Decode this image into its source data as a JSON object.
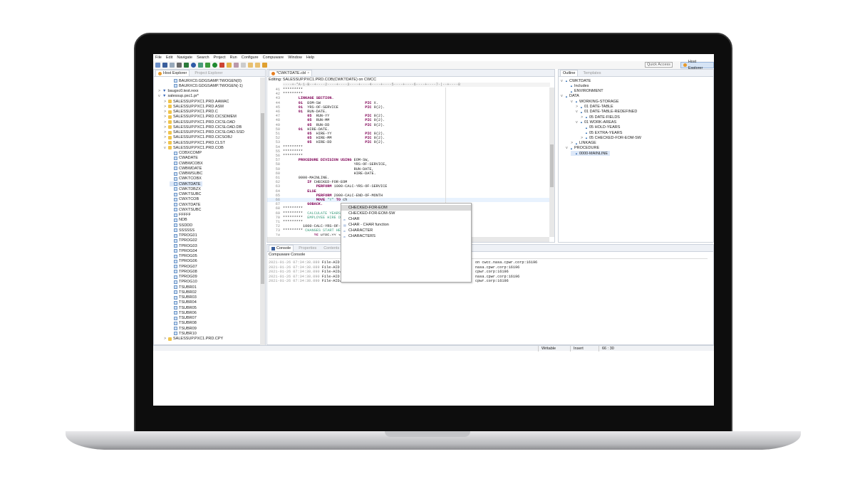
{
  "menu": [
    "File",
    "Edit",
    "Navigate",
    "Search",
    "Project",
    "Run",
    "Configure",
    "Compuware",
    "Window",
    "Help"
  ],
  "quick_access": "Quick Access",
  "perspective": "Host Explorer",
  "left_tabs": [
    "Host Explorer",
    "Project Explorer"
  ],
  "tree": [
    {
      "level": 3,
      "icon": "file",
      "label": "BAURXC0.GDGSAMP.TWOGEN(0)"
    },
    {
      "level": 3,
      "icon": "file",
      "label": "BAURXC0.GDGSAMP.TWOGEN(-1)"
    },
    {
      "level": 1,
      "icon": "filter",
      "label": "baugxc0.test.rexx",
      "toggle": ">"
    },
    {
      "level": 1,
      "icon": "filter",
      "label": "salessup.pxc1.pr*",
      "toggle": "v"
    },
    {
      "level": 2,
      "icon": "folder",
      "label": "SALESSUP.PXC1.PRD.AAMAC",
      "toggle": ">"
    },
    {
      "level": 2,
      "icon": "folder",
      "label": "SALESSUP.PXC1.PRD.ASM",
      "toggle": ">"
    },
    {
      "level": 2,
      "icon": "folder",
      "label": "SALESSUP.PXC1.PRD.C",
      "toggle": ">"
    },
    {
      "level": 2,
      "icon": "folder",
      "label": "SALESSUP.PXC1.PRD.CICSDMEM",
      "toggle": ">"
    },
    {
      "level": 2,
      "icon": "folder",
      "label": "SALESSUP.PXC1.PRD.CICSLOAD",
      "toggle": ">"
    },
    {
      "level": 2,
      "icon": "folder",
      "label": "SALESSUP.PXC1.PRD.CICSLOAD.DB",
      "toggle": ">"
    },
    {
      "level": 2,
      "icon": "folder",
      "label": "SALESSUP.PXC1.PRD.CICSLOAD.SSD",
      "toggle": ">"
    },
    {
      "level": 2,
      "icon": "folder",
      "label": "SALESSUP.PXC1.PRD.CICSOBJ",
      "toggle": ">"
    },
    {
      "level": 2,
      "icon": "folder",
      "label": "SALESSUP.PXC1.PRD.CLST",
      "toggle": ">"
    },
    {
      "level": 2,
      "icon": "folder",
      "label": "SALESSUP.PXC1.PRD.COB",
      "toggle": "v"
    },
    {
      "level": 3,
      "icon": "file",
      "label": "COBXCOMP"
    },
    {
      "level": 3,
      "icon": "file",
      "label": "CWADATE"
    },
    {
      "level": 3,
      "icon": "file",
      "label": "CWBWCOBX"
    },
    {
      "level": 3,
      "icon": "file",
      "label": "CWBWDATE"
    },
    {
      "level": 3,
      "icon": "file",
      "label": "CWBWSUBC"
    },
    {
      "level": 3,
      "icon": "file",
      "label": "CWKTCOBX"
    },
    {
      "level": 3,
      "icon": "file",
      "label": "CWKTDATE",
      "selected": true
    },
    {
      "level": 3,
      "icon": "file",
      "label": "CWKTDBZX"
    },
    {
      "level": 3,
      "icon": "file",
      "label": "CWKTSUBC"
    },
    {
      "level": 3,
      "icon": "file",
      "label": "CWXTCOB"
    },
    {
      "level": 3,
      "icon": "file",
      "label": "CWXTDATE"
    },
    {
      "level": 3,
      "icon": "file",
      "label": "CWXTSUBC"
    },
    {
      "level": 3,
      "icon": "file",
      "label": "FFFFF"
    },
    {
      "level": 3,
      "icon": "file",
      "label": "NDB"
    },
    {
      "level": 3,
      "icon": "file",
      "label": "SSDDD"
    },
    {
      "level": 3,
      "icon": "file",
      "label": "SSSSSS"
    },
    {
      "level": 3,
      "icon": "file",
      "label": "TPROG01"
    },
    {
      "level": 3,
      "icon": "file",
      "label": "TPROG02"
    },
    {
      "level": 3,
      "icon": "file",
      "label": "TPROG03"
    },
    {
      "level": 3,
      "icon": "file",
      "label": "TPROG04"
    },
    {
      "level": 3,
      "icon": "file",
      "label": "TPROG05"
    },
    {
      "level": 3,
      "icon": "file",
      "label": "TPROG06"
    },
    {
      "level": 3,
      "icon": "file",
      "label": "TPROG07"
    },
    {
      "level": 3,
      "icon": "file",
      "label": "TPROG08"
    },
    {
      "level": 3,
      "icon": "file",
      "label": "TPROG09"
    },
    {
      "level": 3,
      "icon": "file",
      "label": "TPROG10"
    },
    {
      "level": 3,
      "icon": "file",
      "label": "TSUBR01"
    },
    {
      "level": 3,
      "icon": "file",
      "label": "TSUBR02"
    },
    {
      "level": 3,
      "icon": "file",
      "label": "TSUBR03"
    },
    {
      "level": 3,
      "icon": "file",
      "label": "TSUBR04"
    },
    {
      "level": 3,
      "icon": "file",
      "label": "TSUBR05"
    },
    {
      "level": 3,
      "icon": "file",
      "label": "TSUBR06"
    },
    {
      "level": 3,
      "icon": "file",
      "label": "TSUBR07"
    },
    {
      "level": 3,
      "icon": "file",
      "label": "TSUBR08"
    },
    {
      "level": 3,
      "icon": "file",
      "label": "TSUBR09"
    },
    {
      "level": 3,
      "icon": "file",
      "label": "TSUBR10"
    },
    {
      "level": 2,
      "icon": "folder",
      "label": "SALESSUP.PXC1.PRD.CPY",
      "toggle": ">"
    }
  ],
  "editor": {
    "tab": "*CWKTDATE.cbl",
    "editing": "Editing: SALESSUP.PXC1.PRD.COB(CWKTDATE) on CWCC",
    "ruler": "----+-*A-1-B--+----2----+----3----+----4----+----5----+----6----+----7-|--+----8",
    "lines": [
      {
        "n": "41",
        "s": [
          [
            "*********",
            "tx"
          ]
        ]
      },
      {
        "n": "42",
        "s": [
          [
            "*********",
            "tx"
          ]
        ]
      },
      {
        "n": "43",
        "s": [
          [
            "       LINKAGE SECTION.",
            "kw"
          ]
        ]
      },
      {
        "n": "44",
        "s": [
          [
            "       01",
            "kw"
          ],
          [
            "  EOM-SW                    ",
            "tx"
          ],
          [
            "PIC",
            "kw"
          ],
          [
            " X.",
            "tx"
          ]
        ]
      },
      {
        "n": "45",
        "s": [
          [
            "       01",
            "kw"
          ],
          [
            "  YRS-OF-SERVICE            ",
            "tx"
          ],
          [
            "PIC",
            "kw"
          ],
          [
            " 9(2).",
            "tx"
          ]
        ]
      },
      {
        "n": "46",
        "s": [
          [
            "       01",
            "kw"
          ],
          [
            "  RUN-DATE.",
            "tx"
          ]
        ]
      },
      {
        "n": "47",
        "s": [
          [
            "           05",
            "kw"
          ],
          [
            "  RUN-YY                ",
            "tx"
          ],
          [
            "PIC",
            "kw"
          ],
          [
            " 9(2).",
            "tx"
          ]
        ]
      },
      {
        "n": "48",
        "s": [
          [
            "           05",
            "kw"
          ],
          [
            "  RUN-MM                ",
            "tx"
          ],
          [
            "PIC",
            "kw"
          ],
          [
            " 9(2).",
            "tx"
          ]
        ]
      },
      {
        "n": "49",
        "s": [
          [
            "           05",
            "kw"
          ],
          [
            "  RUN-DD                ",
            "tx"
          ],
          [
            "PIC",
            "kw"
          ],
          [
            " 9(2).",
            "tx"
          ]
        ]
      },
      {
        "n": "50",
        "s": [
          [
            "       01",
            "kw"
          ],
          [
            "  HIRE-DATE.",
            "tx"
          ]
        ]
      },
      {
        "n": "51",
        "s": [
          [
            "           05",
            "kw"
          ],
          [
            "  HIRE-YY               ",
            "tx"
          ],
          [
            "PIC",
            "kw"
          ],
          [
            " 9(2).",
            "tx"
          ]
        ]
      },
      {
        "n": "52",
        "s": [
          [
            "           05",
            "kw"
          ],
          [
            "  HIRE-MM               ",
            "tx"
          ],
          [
            "PIC",
            "kw"
          ],
          [
            " 9(2).",
            "tx"
          ]
        ]
      },
      {
        "n": "53",
        "s": [
          [
            "           05",
            "kw"
          ],
          [
            "  HIRE-DD               ",
            "tx"
          ],
          [
            "PIC",
            "kw"
          ],
          [
            " 9(2).",
            "tx"
          ]
        ]
      },
      {
        "n": "54",
        "s": [
          [
            "*********",
            "tx"
          ]
        ]
      },
      {
        "n": "55",
        "s": [
          [
            "*********",
            "tx"
          ]
        ]
      },
      {
        "n": "56",
        "s": [
          [
            "*********",
            "tx"
          ]
        ]
      },
      {
        "n": "57",
        "s": [
          [
            "       PROCEDURE DIVISION USING",
            "kw"
          ],
          [
            " EOM-SW,",
            "tx"
          ]
        ]
      },
      {
        "n": "58",
        "s": [
          [
            "                                YRS-OF-SERVICE,",
            "tx"
          ]
        ]
      },
      {
        "n": "59",
        "s": [
          [
            "                                RUN-DATE,",
            "tx"
          ]
        ]
      },
      {
        "n": "60",
        "s": [
          [
            "                                HIRE-DATE.",
            "tx"
          ]
        ]
      },
      {
        "n": "61",
        "s": [
          [
            "       0000-MAINLINE.",
            "tx"
          ]
        ]
      },
      {
        "n": "62",
        "s": [
          [
            "           IF",
            "kw"
          ],
          [
            " CHECKED-FOR-EOM",
            "tx"
          ]
        ]
      },
      {
        "n": "63",
        "s": [
          [
            "               PERFORM",
            "kw"
          ],
          [
            " 1000-CALC-YRS-OF-SERVICE",
            "tx"
          ]
        ]
      },
      {
        "n": "64",
        "s": [
          [
            "           ELSE",
            "kw"
          ]
        ]
      },
      {
        "n": "65",
        "s": [
          [
            "               PERFORM",
            "kw"
          ],
          [
            " 2000-CALC-END-OF-MONTH",
            "tx"
          ]
        ]
      },
      {
        "n": "66",
        "s": [
          [
            "               MOVE",
            "kw"
          ],
          [
            " \"Y\" ",
            "cm"
          ],
          [
            "TO",
            "kw"
          ],
          [
            " ch",
            "tx"
          ]
        ],
        "current": true
      },
      {
        "n": "67",
        "s": [
          [
            "           GOBACK.",
            "kw"
          ]
        ]
      },
      {
        "n": "68",
        "s": [
          [
            "*********",
            "tx"
          ]
        ]
      },
      {
        "n": "69",
        "s": [
          [
            "*********  ",
            "tx"
          ],
          [
            "CALCULATE YEARS OF SERVICE",
            "cm"
          ]
        ]
      },
      {
        "n": "70",
        "s": [
          [
            "*********  ",
            "tx"
          ],
          [
            "EMPLOYEE HIRE DATE",
            "cm"
          ]
        ]
      },
      {
        "n": "71",
        "s": [
          [
            "*********",
            "tx"
          ]
        ]
      },
      {
        "n": "72",
        "s": [
          [
            "         1000-CALC-YRS-OF-SERVICE.",
            "tx"
          ]
        ]
      },
      {
        "n": "73",
        "s": [
          [
            "********* ",
            "tx"
          ],
          [
            "CHANGES START HERE",
            "cm"
          ]
        ]
      },
      {
        "n": "74",
        "s": [
          [
            "              IF",
            "kw"
          ],
          [
            " HIRE-YY > RUN-YY",
            "tx"
          ]
        ]
      }
    ]
  },
  "autocomplete": [
    {
      "icon": "",
      "label": "CHECKED-FOR-EOM",
      "selected": true
    },
    {
      "icon": "",
      "label": "CHECKED-FOR-EOM-SW"
    },
    {
      "icon": "w",
      "label": "CHAR"
    },
    {
      "icon": "f",
      "label": "CHAR - CHAR function"
    },
    {
      "icon": "w",
      "label": "CHARACTER"
    },
    {
      "icon": "w",
      "label": "CHARACTERS"
    }
  ],
  "outline": {
    "tabs": [
      "Outline",
      "Templates"
    ],
    "items": [
      {
        "level": 0,
        "toggle": "v",
        "label": "CWKTDATE"
      },
      {
        "level": 1,
        "label": "Includes"
      },
      {
        "level": 1,
        "label": "ENVIRONMENT"
      },
      {
        "level": 0,
        "toggle": "v",
        "label": "DATA",
        "indent": 1
      },
      {
        "level": 2,
        "toggle": "v",
        "label": "WORKING-STORAGE"
      },
      {
        "level": 3,
        "toggle": ">",
        "label": "01 DATE-TABLE"
      },
      {
        "level": 3,
        "toggle": "v",
        "label": "01 DATE-TABLE-REDEFINED"
      },
      {
        "level": 4,
        "toggle": ">",
        "label": "05 DATE-FIELDS"
      },
      {
        "level": 3,
        "toggle": "v",
        "label": "01 WORK-AREAS"
      },
      {
        "level": 4,
        "label": "05 HOLD-YEARS"
      },
      {
        "level": 4,
        "label": "05 EXTRA-YEARS"
      },
      {
        "level": 4,
        "toggle": ">",
        "label": "05 CHECKED-FOR-EOM-SW"
      },
      {
        "level": 2,
        "toggle": ">",
        "label": "LINKAGE"
      },
      {
        "level": 1,
        "toggle": "v",
        "label": "PROCEDURE"
      },
      {
        "level": 2,
        "label": "0000-MAINLINE",
        "selected": true
      }
    ]
  },
  "console": {
    "tabs": [
      "Console",
      "Properties",
      "Contents"
    ],
    "title": "Compuware Console",
    "lines": [
      {
        "ts": "2021-01-26 07:34:38.089",
        "left": "File-AID Co",
        "right": "on cwcc.nasa.cpwr.corp:16196"
      },
      {
        "ts": "2021-01-26 07:34:38.089",
        "left": "File-AID fo",
        "right": "nasa.cpwr.corp:16196"
      },
      {
        "ts": "2021-01-26 07:34:38.090",
        "left": "File-AID/MV",
        "right": "cpwr.corp:16196"
      },
      {
        "ts": "2021-01-26 07:34:38.090",
        "left": "File-AID fo",
        "right": "nasa.cpwr.corp:16196"
      },
      {
        "ts": "2021-01-26 07:34:38.090",
        "left": "File-AID/RD",
        "right": "cpwr.corp:16196"
      }
    ]
  },
  "status": {
    "writable": "Writable",
    "mode": "Insert",
    "position": "66 : 30"
  }
}
